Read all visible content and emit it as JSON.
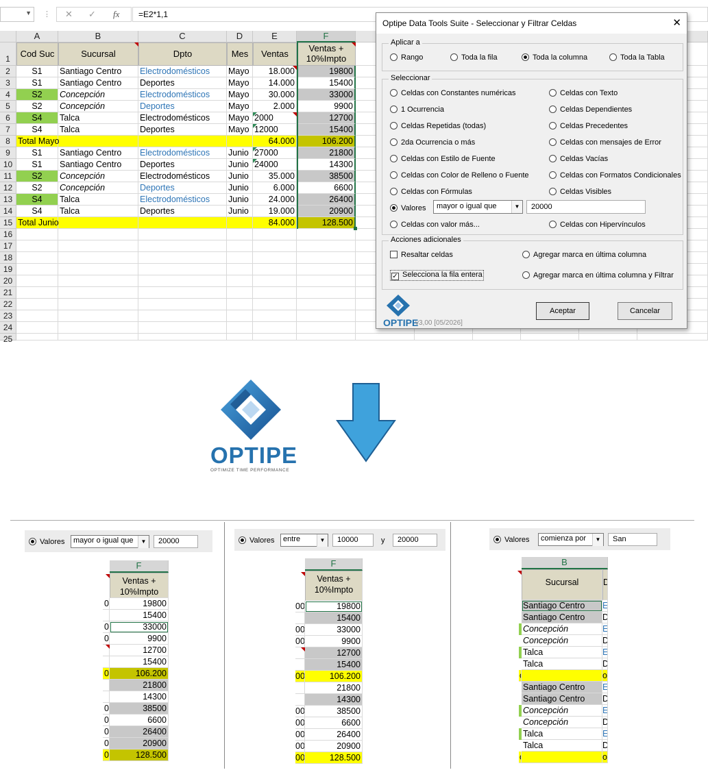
{
  "formula_bar": {
    "fx": "fx",
    "formula": "=E2*1,1"
  },
  "sheet": {
    "columns": [
      "A",
      "B",
      "C",
      "D",
      "E",
      "F"
    ],
    "headers": [
      "Cod Suc",
      "Sucursal",
      "Dpto",
      "Mes",
      "Ventas",
      "Ventas +\n10%Impto"
    ],
    "row_numbers": [
      "1",
      "2",
      "3",
      "4",
      "5",
      "6",
      "7",
      "8",
      "9",
      "10",
      "11",
      "12",
      "13",
      "14",
      "15",
      "16",
      "17",
      "18",
      "19",
      "20",
      "21",
      "22",
      "23",
      "24",
      "25"
    ],
    "rows": [
      {
        "a": "S1",
        "b": "Santiago Centro",
        "c": "Electrodomésticos",
        "d": "Mayo",
        "e": "18.000",
        "f": "19800"
      },
      {
        "a": "S1",
        "b": "Santiago Centro",
        "c": "Deportes",
        "d": "Mayo",
        "e": "14.000",
        "f": "15400"
      },
      {
        "a": "S2",
        "b": "Concepción",
        "c": "Electrodomésticos",
        "d": "Mayo",
        "e": "30.000",
        "f": "33000"
      },
      {
        "a": "S2",
        "b": "Concepción",
        "c": "Deportes",
        "d": "Mayo",
        "e": "2.000",
        "f": "9900"
      },
      {
        "a": "S4",
        "b": "Talca",
        "c": "Electrodomésticos",
        "d": "Mayo",
        "e": "2000",
        "f": "12700"
      },
      {
        "a": "S4",
        "b": "Talca",
        "c": "Deportes",
        "d": "Mayo",
        "e": "12000",
        "f": "15400"
      },
      {
        "a": "Total Mayo",
        "b": "",
        "c": "",
        "d": "",
        "e": "64.000",
        "f": "106.200"
      },
      {
        "a": "S1",
        "b": "Santiago Centro",
        "c": "Electrodomésticos",
        "d": "Junio",
        "e": "27000",
        "f": "21800"
      },
      {
        "a": "S1",
        "b": "Santiago Centro",
        "c": "Deportes",
        "d": "Junio",
        "e": "24000",
        "f": "14300"
      },
      {
        "a": "S2",
        "b": "Concepción",
        "c": "Electrodomésticos",
        "d": "Junio",
        "e": "35.000",
        "f": "38500"
      },
      {
        "a": "S2",
        "b": "Concepción",
        "c": "Deportes",
        "d": "Junio",
        "e": "6.000",
        "f": "6600"
      },
      {
        "a": "S4",
        "b": "Talca",
        "c": "Electrodomésticos",
        "d": "Junio",
        "e": "24.000",
        "f": "26400"
      },
      {
        "a": "S4",
        "b": "Talca",
        "c": "Deportes",
        "d": "Junio",
        "e": "19.000",
        "f": "20900"
      },
      {
        "a": "Total Junio",
        "b": "",
        "c": "",
        "d": "",
        "e": "84.000",
        "f": "128.500"
      }
    ]
  },
  "dialog": {
    "title": "Optipe Data Tools Suite - Seleccionar y Filtrar Celdas",
    "close": "✕",
    "aplicar_label": "Aplicar a",
    "aplicar_options": [
      "Rango",
      "Toda la fila",
      "Toda la columna",
      "Toda la Tabla"
    ],
    "seleccionar_label": "Seleccionar",
    "left_options": [
      "Celdas con Constantes numéricas",
      "1 Ocurrencia",
      "Celdas Repetidas (todas)",
      "2da Ocurrencia o más",
      "Celdas con Estilo de Fuente",
      "Celdas con Color de Relleno o Fuente",
      "Celdas con Fórmulas",
      "Valores",
      "Celdas con valor más..."
    ],
    "right_options": [
      "Celdas con Texto",
      "Celdas Dependientes",
      "Celdas Precedentes",
      "Celdas con mensajes de Error",
      "Celdas Vacías",
      "Celdas con Formatos Condicionales",
      "Celdas Visibles",
      "Celdas con Hipervínculos"
    ],
    "valores_combo": "mayor o igual que",
    "valores_input": "20000",
    "acciones_label": "Acciones adicionales",
    "acciones": [
      "Resaltar celdas",
      "Selecciona la fila entera",
      "Agregar marca en última columna",
      "Agregar marca en última columna y Filtrar"
    ],
    "aceptar": "Aceptar",
    "cancelar": "Cancelar",
    "brand": "OPTIPE",
    "version": "v3,00 [05/2026]"
  },
  "logo": {
    "name": "OPTIPE",
    "tagline": "OPTIMIZE TIME PERFORMANCE"
  },
  "colors": {
    "yellow": "#ffff00",
    "green": "#92d050",
    "gray": "#c8c8c8",
    "header": "#ddd9c4",
    "arrow": "#3fa2dc",
    "brand": "#2672ae"
  },
  "examples": [
    {
      "label": "Valores",
      "combo": "mayor o igual que",
      "value1": "20000",
      "col": "F",
      "header": "Ventas +\n10%Impto",
      "cells": [
        "19800",
        "15400",
        "33000",
        "9900",
        "12700",
        "15400",
        "106.200",
        "21800",
        "14300",
        "38500",
        "6600",
        "26400",
        "20900",
        "128.500"
      ],
      "edge": [
        "0",
        "",
        "0",
        "0",
        "",
        "",
        "0",
        "",
        "",
        "0",
        "0",
        "0",
        "0",
        "0"
      ]
    },
    {
      "label": "Valores",
      "combo": "entre",
      "value1": "10000",
      "and": "y",
      "value2": "20000",
      "col": "F",
      "header": "Ventas +\n10%Impto",
      "cells": [
        "19800",
        "15400",
        "33000",
        "9900",
        "12700",
        "15400",
        "106.200",
        "21800",
        "14300",
        "38500",
        "6600",
        "26400",
        "20900",
        "128.500"
      ],
      "edge": [
        "00",
        "",
        "00",
        "00",
        "",
        "",
        "00",
        "",
        "",
        "00",
        "00",
        "00",
        "00",
        "00"
      ]
    },
    {
      "label": "Valores",
      "combo": "comienza por",
      "value1": "San",
      "col": "B",
      "header": "Sucursal",
      "right_hdr": "D",
      "cells": [
        "Santiago Centro",
        "Santiago Centro",
        "Concepción",
        "Concepción",
        "Talca",
        "Talca",
        "",
        "Santiago Centro",
        "Santiago Centro",
        "Concepción",
        "Concepción",
        "Talca",
        "Talca",
        ""
      ],
      "edge": [
        "E",
        "D",
        "E",
        "D",
        "E",
        "D",
        "o",
        "E",
        "D",
        "E",
        "D",
        "E",
        "D",
        "o"
      ]
    }
  ]
}
